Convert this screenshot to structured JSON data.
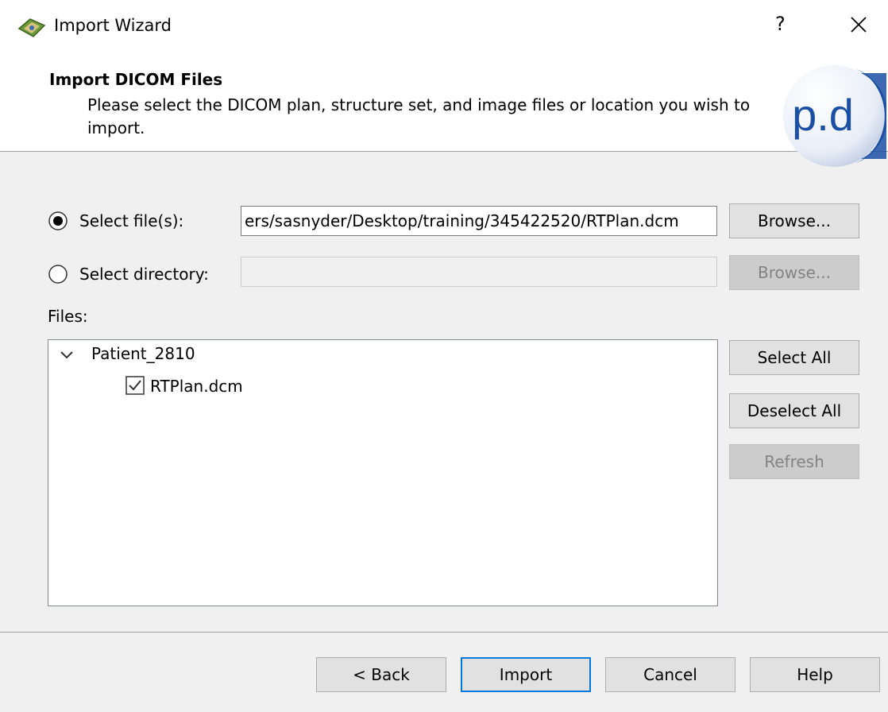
{
  "window": {
    "title": "Import Wizard",
    "help_label": "?",
    "close_icon": "close-icon"
  },
  "header": {
    "title": "Import DICOM Files",
    "description": "Please select the DICOM plan, structure set, and image files or location you wish to import.",
    "logo_text": "p.d"
  },
  "source": {
    "select_files": {
      "label": "Select file(s):",
      "selected": true,
      "value": "ers/sasnyder/Desktop/training/345422520/RTPlan.dcm",
      "browse_label": "Browse..."
    },
    "select_directory": {
      "label": "Select directory:",
      "selected": false,
      "value": "",
      "browse_label": "Browse...",
      "enabled": false
    }
  },
  "files": {
    "label": "Files:",
    "tree": [
      {
        "label": "Patient_2810",
        "expanded": true,
        "children": [
          {
            "label": "RTPlan.dcm",
            "checked": true
          }
        ]
      }
    ],
    "select_all_label": "Select All",
    "deselect_all_label": "Deselect All",
    "refresh_label": "Refresh"
  },
  "footer": {
    "back_label": "< Back",
    "import_label": "Import",
    "cancel_label": "Cancel",
    "help_label": "Help"
  },
  "colors": {
    "accent": "#0078d7",
    "dialog_bg": "#f0f0f0",
    "logo_blue": "#1a4fa3"
  }
}
